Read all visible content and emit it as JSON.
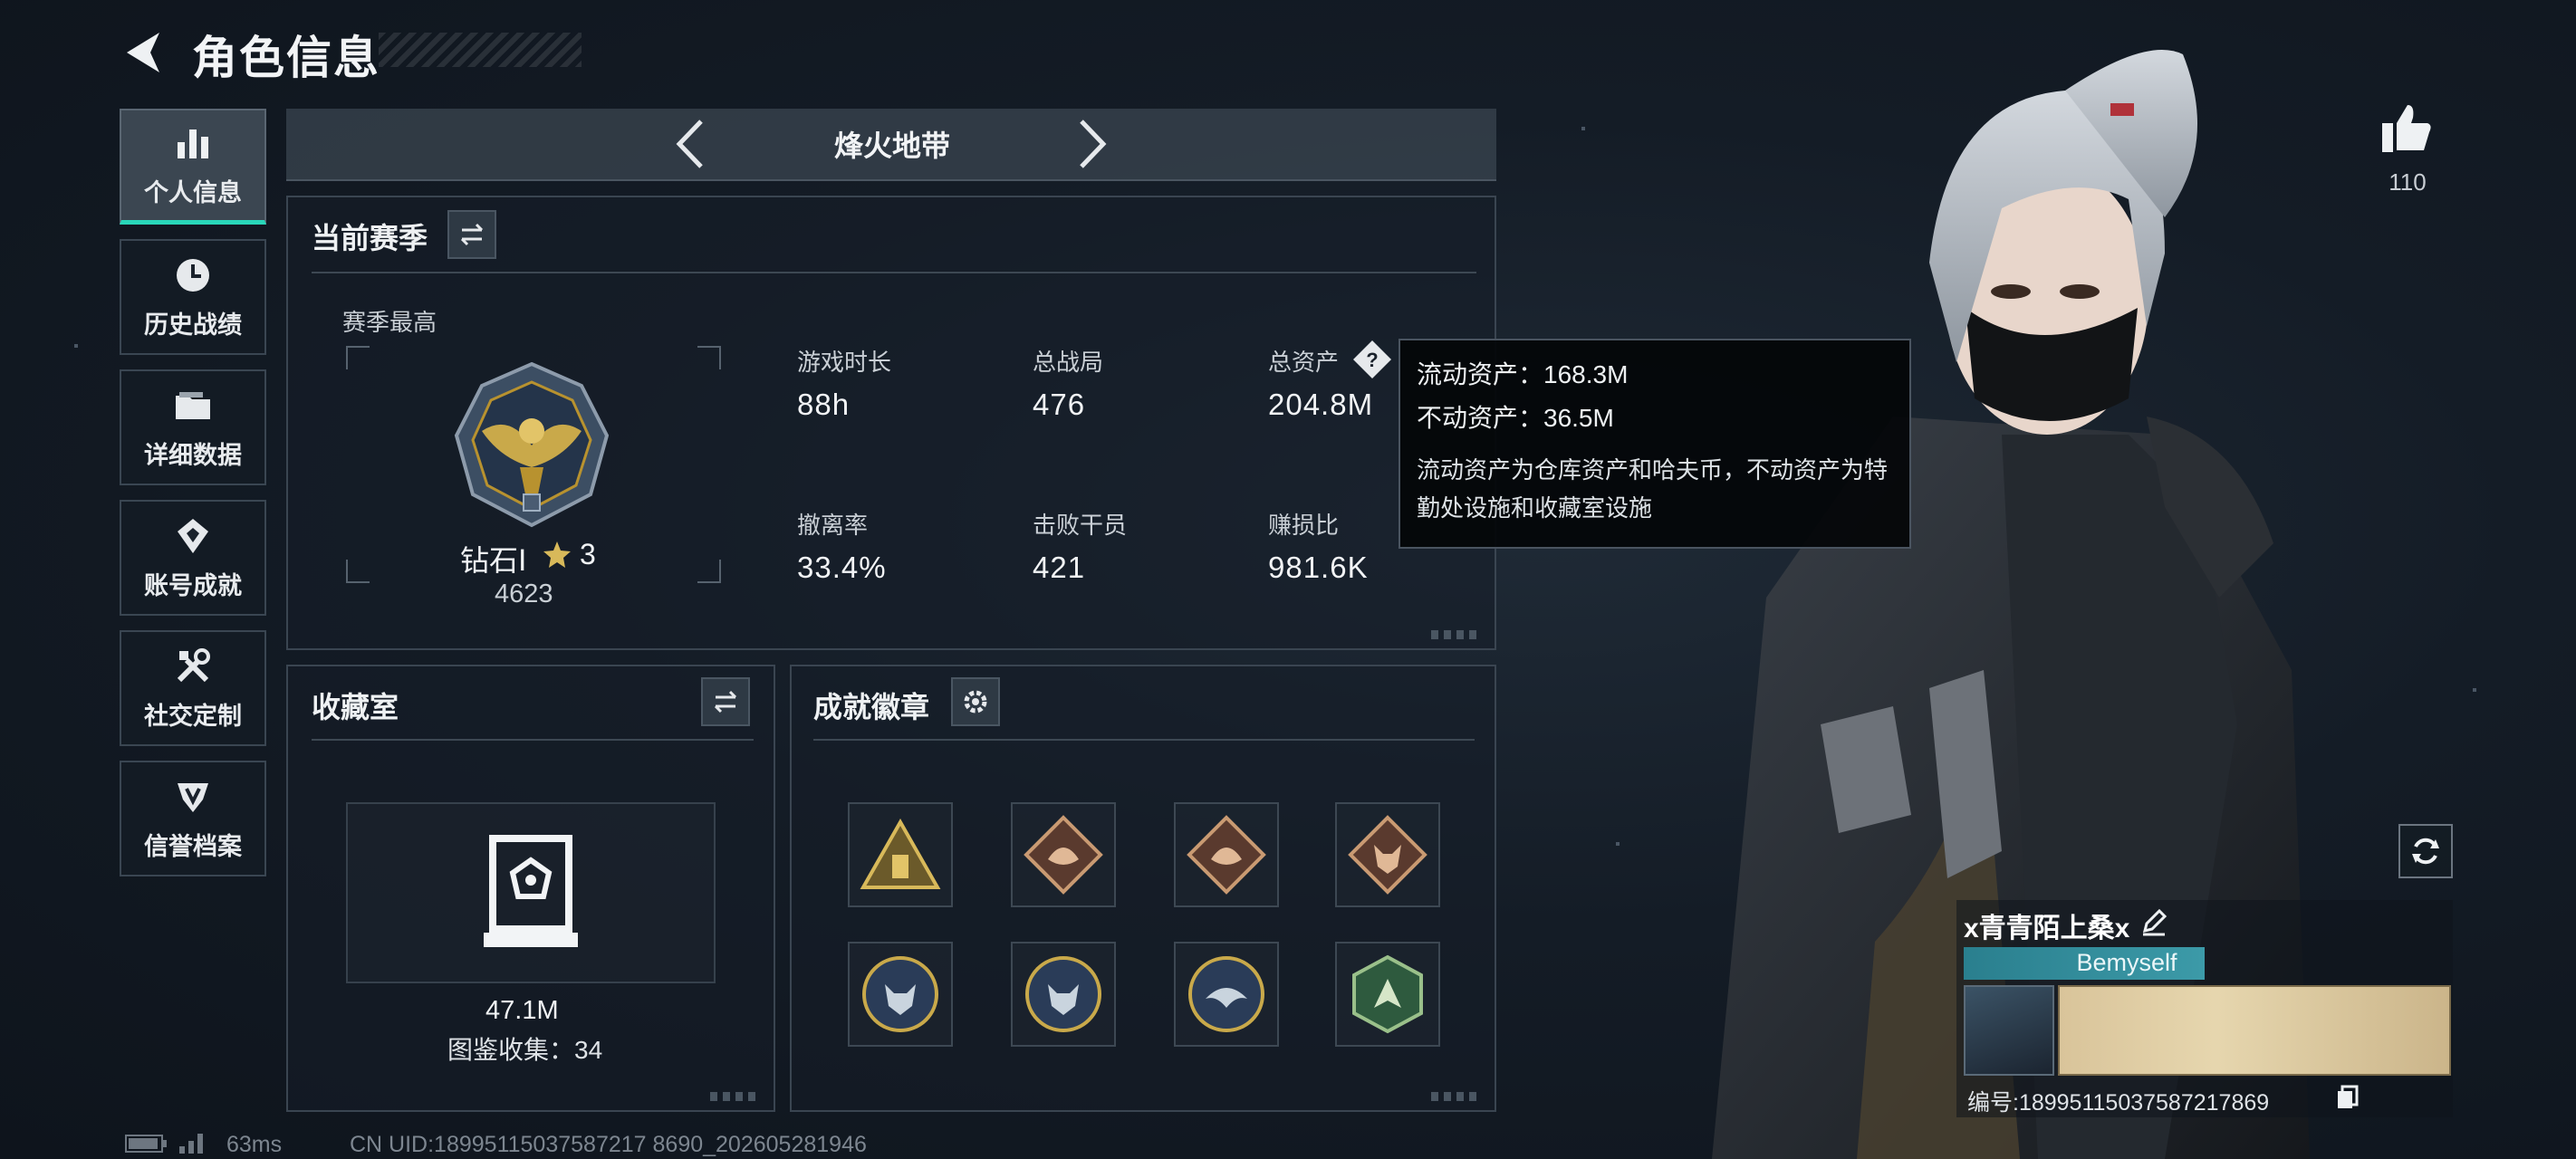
{
  "header": {
    "title": "角色信息"
  },
  "nav": [
    {
      "label": "个人信息",
      "icon": "bar-chart-icon",
      "active": true
    },
    {
      "label": "历史战绩",
      "icon": "history-icon",
      "active": false
    },
    {
      "label": "详细数据",
      "icon": "folder-icon",
      "active": false
    },
    {
      "label": "账号成就",
      "icon": "achievement-icon",
      "active": false
    },
    {
      "label": "社交定制",
      "icon": "tools-icon",
      "active": false
    },
    {
      "label": "信誉档案",
      "icon": "credit-icon",
      "active": false
    }
  ],
  "mode": {
    "title": "烽火地带"
  },
  "season": {
    "header": "当前赛季",
    "best_label": "赛季最高",
    "rank": {
      "name": "钻石Ⅰ",
      "stars": "3",
      "score": "4623"
    },
    "stats": [
      {
        "label": "游戏时长",
        "value": "88h"
      },
      {
        "label": "总战局",
        "value": "476"
      },
      {
        "label": "总资产",
        "value": "204.8M"
      },
      {
        "label": "撤离率",
        "value": "33.4%"
      },
      {
        "label": "击败干员",
        "value": "421"
      },
      {
        "label": "赚损比",
        "value": "981.6K"
      }
    ]
  },
  "tooltip": {
    "liquid": "流动资产：168.3M",
    "fixed": "不动资产：36.5M",
    "desc": "流动资产为仓库资产和哈夫币，不动资产为特勤处设施和收藏室设施"
  },
  "collection": {
    "header": "收藏室",
    "value": "47.1M",
    "count": "图鉴收集：34"
  },
  "badges": {
    "header": "成就徽章",
    "items": [
      "badge-triangle-icon",
      "badge-dragon-icon",
      "badge-dragon-icon",
      "badge-wolf-icon",
      "badge-wolf-round-icon",
      "badge-wolf-round-icon",
      "badge-eagle-round-icon",
      "badge-hex-beast-icon"
    ]
  },
  "likes": {
    "count": "110"
  },
  "player": {
    "name": "x青青陌上桑x",
    "tag": "Bemyself",
    "id": "编号:18995115037587217869"
  },
  "footer": {
    "ping": "63ms",
    "uid": "CN UID:18995115037587217 8690_202605281946"
  },
  "colors": {
    "accent": "#29d6b9",
    "gold": "#c9a94a"
  }
}
